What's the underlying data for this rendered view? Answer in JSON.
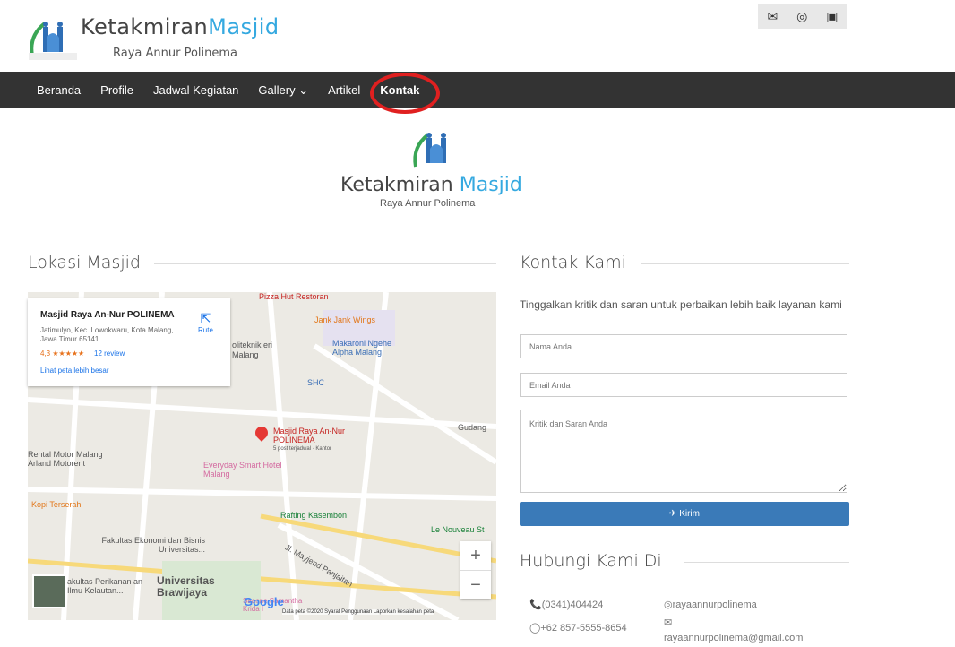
{
  "brand": {
    "main": "Ketakmiran",
    "accent": "Masjid",
    "sub": "Raya Annur Polinema"
  },
  "socials": {
    "mail": "✉",
    "instagram": "◎",
    "youtube": "▣"
  },
  "nav": {
    "items": [
      "Beranda",
      "Profile",
      "Jadwal Kegiatan",
      "Gallery ⌄",
      "Artikel",
      "Kontak"
    ]
  },
  "center_logo": {
    "main": "Ketakmiran",
    "accent": "Masjid",
    "sub": "Raya Annur Polinema"
  },
  "location": {
    "title": "Lokasi Masjid"
  },
  "map": {
    "card": {
      "name": "Masjid Raya An-Nur POLINEMA",
      "address": "Jatimulyo, Kec. Lowokwaru, Kota Malang, Jawa Timur 65141",
      "rating": "4,3 ★★★★★",
      "reviews": "12 review",
      "bigger_map": "Lihat peta lebih besar",
      "route": "Rute"
    },
    "labels": {
      "pizza": "Pizza Hut Restoran",
      "jank": "Jank Jank Wings",
      "makaroni": "Makaroni Ngehe Alpha Malang",
      "politeknik": "oliteknik eri Malang",
      "shc": "SHC",
      "gudang": "Gudang",
      "marker_line1": "Masjid Raya An-Nur",
      "marker_line2": "POLINEMA",
      "marker_note": "5 post terjadwal · Kantor",
      "rental": "Rental Motor Malang Arland Motorent",
      "everyday": "Everyday Smart Hotel Malang",
      "kopi": "Kopi Terserah",
      "rafting": "Rafting Kasembon",
      "nouveau": "Le Nouveau St",
      "ekonomi": "Fakultas Ekonomi dan Bisnis Universitas...",
      "perikanan": "akultas Perikanan an Ilmu Kelautan...",
      "ub": "Universitas Brawijaya",
      "samantha": "Saaone Samantha Krida I",
      "mayjend": "Jl. Mayjend Panjaitan"
    },
    "zoom_in": "+",
    "zoom_out": "−",
    "google": "Google",
    "attribution": "Data peta ©2020   Syarat Penggunaan   Laporkan kesalahan peta"
  },
  "contact_form": {
    "title": "Kontak Kami",
    "intro": "Tinggalkan kritik dan saran untuk perbaikan lebih baik layanan kami",
    "name_placeholder": "Nama Anda",
    "email_placeholder": "Email Anda",
    "message_placeholder": "Kritik dan Saran Anda",
    "submit": "✈ Kirim"
  },
  "reach": {
    "title": "Hubungi Kami Di",
    "phone": "📞(0341)404424",
    "whatsapp": "◯+62 857-5555-8654",
    "instagram": "◎rayaannurpolinema",
    "email_icon": "✉",
    "email": "rayaannurpolinema@gmail.com"
  }
}
